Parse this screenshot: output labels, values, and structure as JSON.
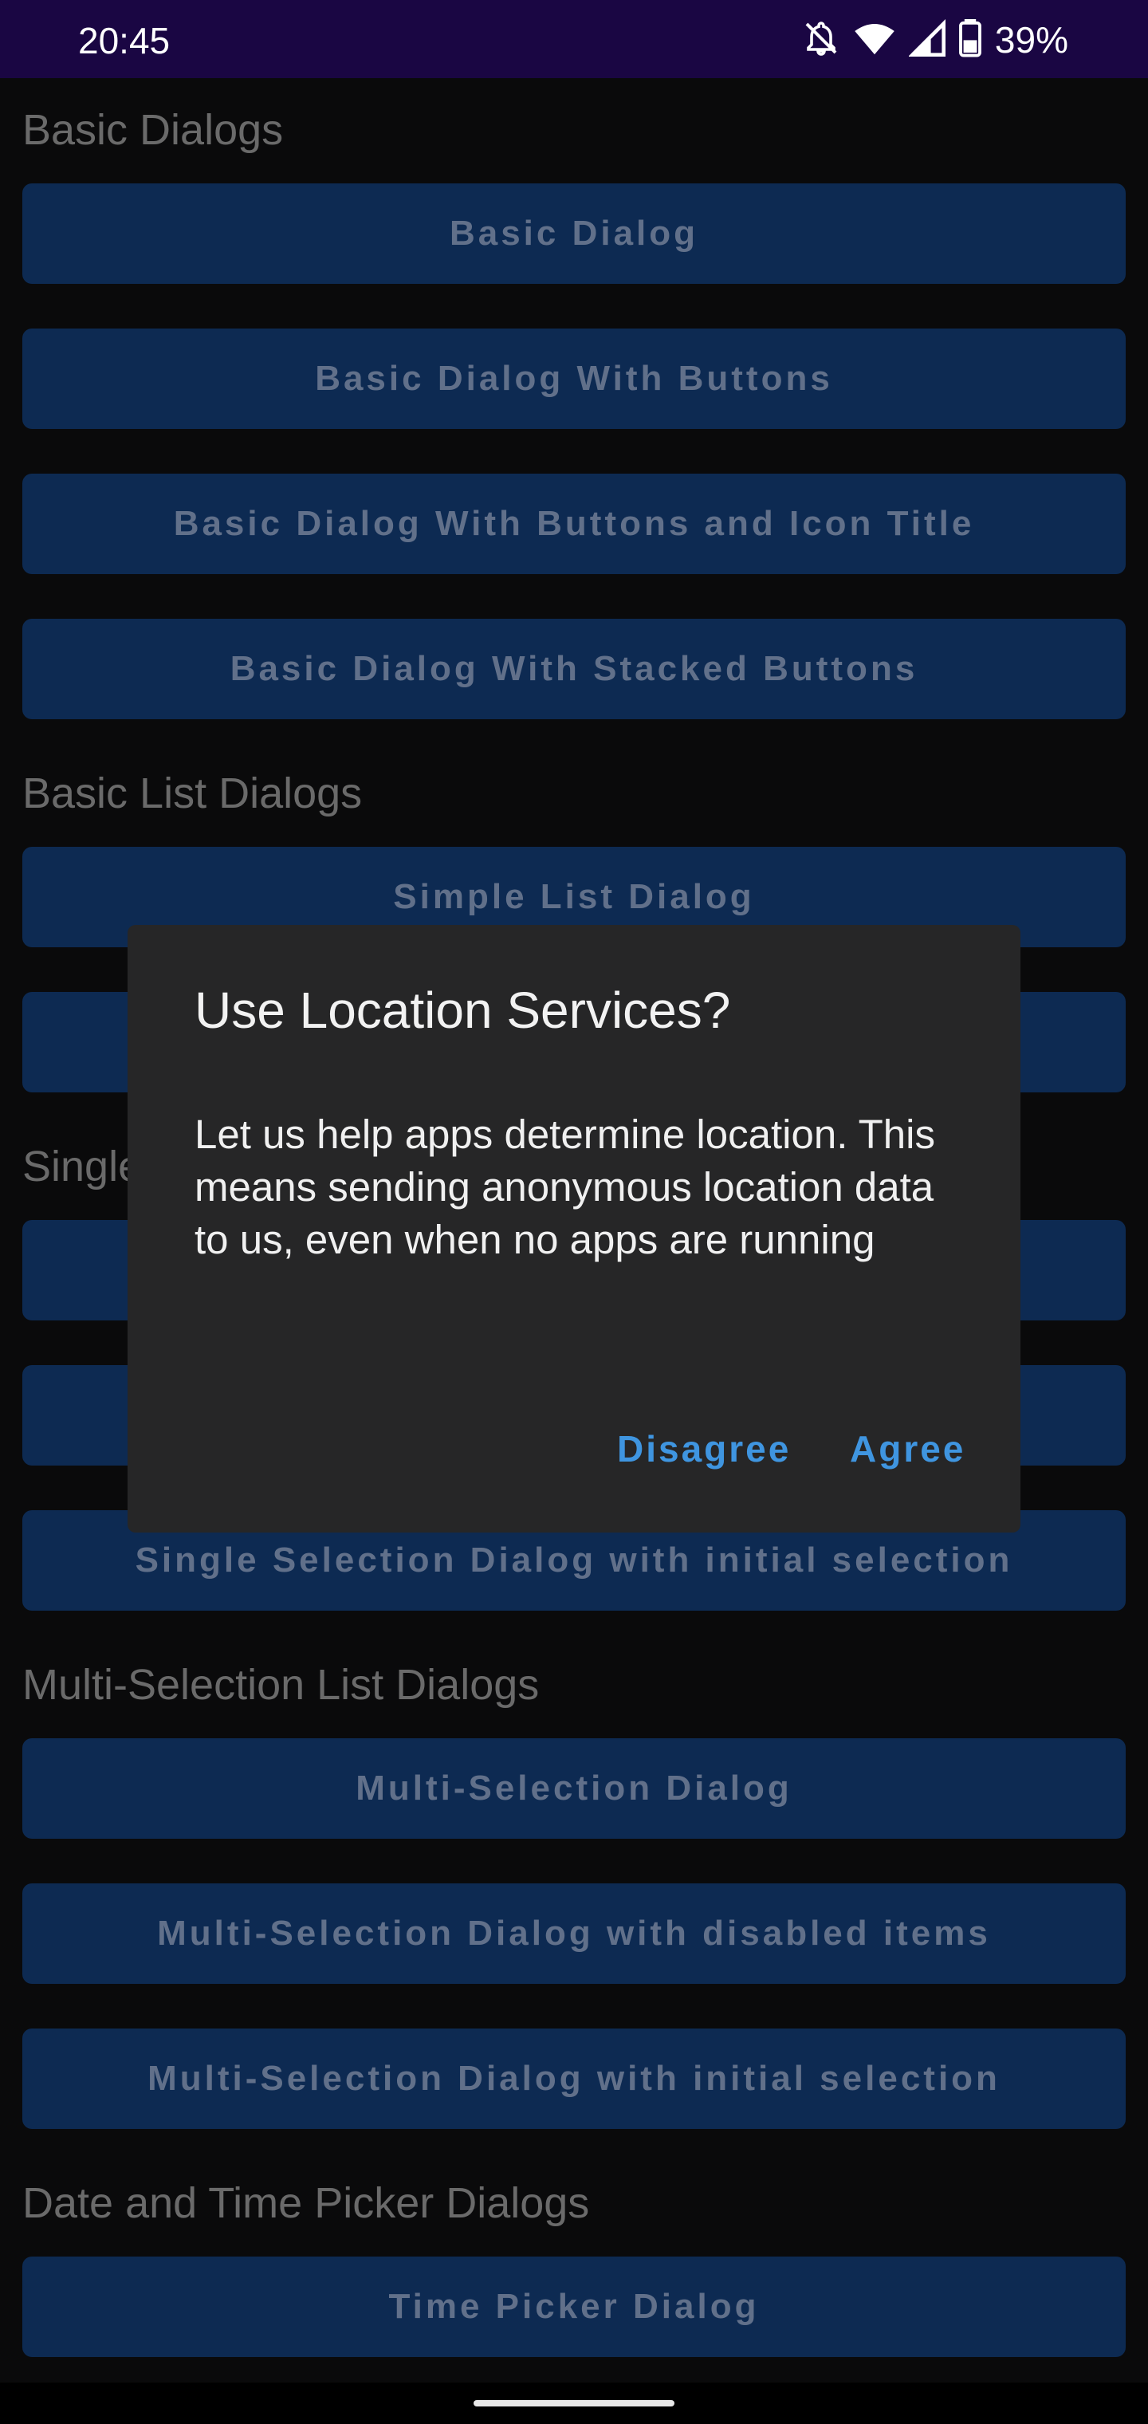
{
  "status_bar": {
    "time": "20:45",
    "battery_percent": "39%",
    "icons": [
      "bell-off-icon",
      "wifi-icon",
      "cell-signal-icon",
      "battery-icon"
    ]
  },
  "sections": {
    "basic_dialogs": {
      "title": "Basic Dialogs",
      "buttons": [
        "Basic Dialog",
        "Basic Dialog With Buttons",
        "Basic Dialog With Buttons and Icon Title",
        "Basic Dialog With Stacked Buttons"
      ]
    },
    "basic_list_dialogs": {
      "title": "Basic List Dialogs",
      "buttons": [
        "Simple List Dialog",
        ""
      ]
    },
    "single_selection": {
      "title": "Single",
      "buttons": [
        "",
        "",
        "Single Selection Dialog with initial selection"
      ]
    },
    "multi_selection": {
      "title": "Multi-Selection List Dialogs",
      "buttons": [
        "Multi-Selection Dialog",
        "Multi-Selection Dialog with disabled items",
        "Multi-Selection Dialog with initial selection"
      ]
    },
    "date_time": {
      "title": "Date and Time Picker Dialogs",
      "buttons": [
        "Time Picker Dialog"
      ]
    }
  },
  "dialog": {
    "title": "Use Location Services?",
    "message": "Let us help apps determine location. This means sending anonymous location data to us, even when no apps are running",
    "negative": "Disagree",
    "positive": "Agree"
  },
  "colors": {
    "status_bar": "#1a0643",
    "background": "#0a0a0b",
    "button": "#0d2a52",
    "dialog": "#262627",
    "accent": "#3f95e0"
  }
}
